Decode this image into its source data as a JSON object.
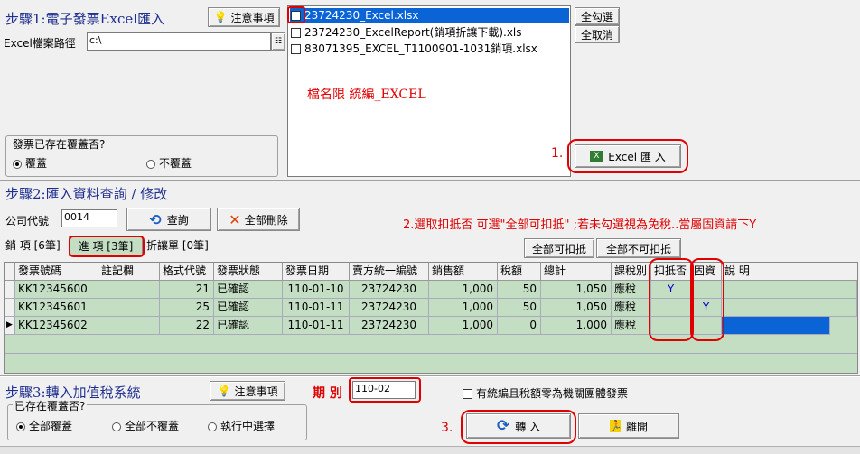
{
  "step1": {
    "title": "步驟1:電子發票Excel匯入",
    "notice_label": "注意事項",
    "path_label": "Excel檔案路徑",
    "path_value": "c:\\",
    "files": [
      {
        "name": "23724230_Excel.xlsx",
        "checked": true,
        "selected": true
      },
      {
        "name": "23724230_ExcelReport(銷項折讓下載).xls",
        "checked": false,
        "selected": false
      },
      {
        "name": "83071395_EXCEL_T1100901-1031銷項.xlsx",
        "checked": false,
        "selected": false
      }
    ],
    "select_all": "全勾選",
    "clear_all": "全取消",
    "filename_hint": "檔名限 統編_EXCEL",
    "overwrite_group": "發票已存在覆蓋否?",
    "overwrite_yes": "覆蓋",
    "overwrite_no": "不覆蓋",
    "step_marker": "1.",
    "import_button": "Excel 匯 入"
  },
  "step2": {
    "title": "步驟2:匯入資料查詢 / 修改",
    "company_label": "公司代號",
    "company_value": "0014",
    "query_button": "查詢",
    "delete_all_button": "全部刪除",
    "instruction": "2.選取扣抵否 可選\"全部可扣抵\" ;若未勾選視為免稅..當屬固資請下Y",
    "tabs": [
      "銷 項 [6筆]",
      "進 項 [3筆]",
      "折讓單 [0筆]"
    ],
    "all_deductible_button": "全部可扣抵",
    "all_nondeductible_button": "全部不可扣抵",
    "columns": [
      "發票號碼",
      "註記欄",
      "格式代號",
      "發票狀態",
      "發票日期",
      "賣方統一編號",
      "銷售額",
      "稅額",
      "總計",
      "課稅別",
      "扣抵否",
      "固資",
      "說 明"
    ],
    "rows": [
      {
        "invoice": "KK12345600",
        "note": "",
        "format": "21",
        "status": "已確認",
        "date": "110-01-10",
        "seller": "23724230",
        "sales": "1,000",
        "tax": "50",
        "total": "1,050",
        "taxtype": "應稅",
        "deduct": "Y",
        "asset": "",
        "desc": ""
      },
      {
        "invoice": "KK12345601",
        "note": "",
        "format": "25",
        "status": "已確認",
        "date": "110-01-11",
        "seller": "23724230",
        "sales": "1,000",
        "tax": "50",
        "total": "1,050",
        "taxtype": "應稅",
        "deduct": "",
        "asset": "Y",
        "desc": ""
      },
      {
        "invoice": "KK12345602",
        "note": "",
        "format": "22",
        "status": "已確認",
        "date": "110-01-11",
        "seller": "23724230",
        "sales": "1,000",
        "tax": "0",
        "total": "1,000",
        "taxtype": "應稅",
        "deduct": "",
        "asset": "",
        "desc": ""
      }
    ]
  },
  "step3": {
    "title": "步驟3:轉入加值稅系統",
    "notice_label": "注意事項",
    "period_label": "期 別",
    "period_value": "110-02",
    "org_checkbox": "有統編且稅額零為機關團體發票",
    "exists_group": "已存在覆蓋否?",
    "options": [
      "全部覆蓋",
      "全部不覆蓋",
      "執行中選擇"
    ],
    "step_marker": "3.",
    "transfer_button": "轉 入",
    "exit_button": "離開"
  },
  "colors": {
    "accent_red": "#e00000",
    "title_blue": "#1f2f8f",
    "grid_green": "#c3dec3",
    "selection_blue": "#0a64d6"
  }
}
